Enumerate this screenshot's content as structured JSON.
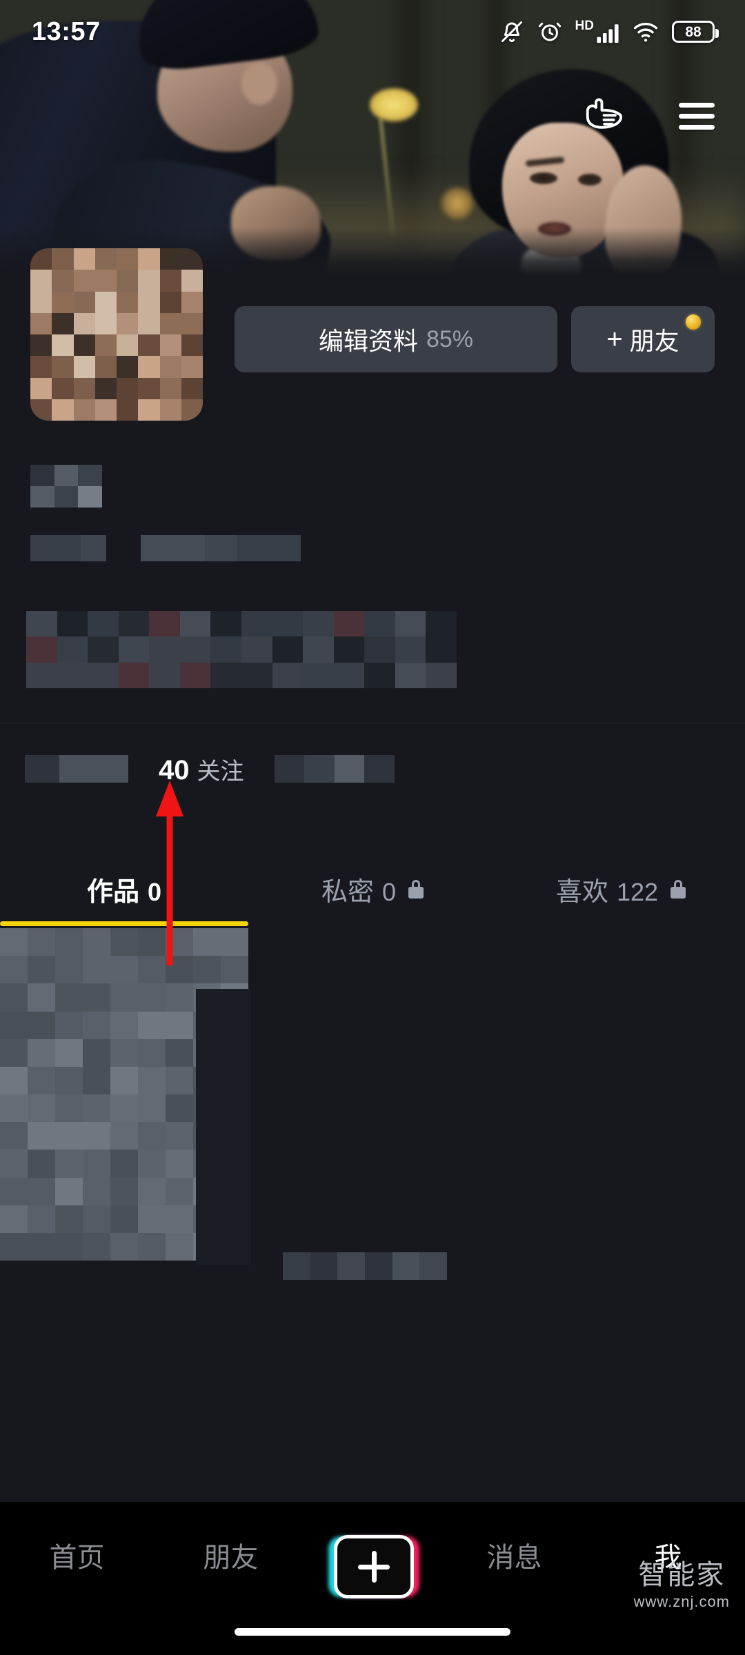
{
  "status_bar": {
    "time": "13:57",
    "hd_label": "HD",
    "battery_level": "88",
    "icons": [
      "bell-mute-icon",
      "alarm-clock-icon",
      "hd-signal-icon",
      "wifi-icon",
      "battery-icon"
    ]
  },
  "cover": {
    "description": "elderly man offering a yellow flower to a woman in a park",
    "pointer_icon": "pointing-hand-icon",
    "menu_icon": "hamburger-menu-icon"
  },
  "profile": {
    "avatar_label": "profile-avatar-mosaic",
    "edit_button": {
      "label": "编辑资料",
      "percent": "85%"
    },
    "friend_button": {
      "plus": "+",
      "label": "朋友",
      "badge": "coin-badge"
    },
    "name_redacted": "",
    "info_redacted": "",
    "bio_redacted": ""
  },
  "stats": {
    "left_redacted": "",
    "following": {
      "count": "40",
      "label": "关注"
    },
    "right_redacted": ""
  },
  "tabs": [
    {
      "label": "作品",
      "count": "0",
      "locked": false,
      "active": true
    },
    {
      "label": "私密",
      "count": "0",
      "locked": true,
      "active": false
    },
    {
      "label": "喜欢",
      "count": "122",
      "locked": true,
      "active": false
    }
  ],
  "content": {
    "card_label": "video-thumbnail-mosaic",
    "caption_redacted": ""
  },
  "annotation": {
    "type": "arrow-up",
    "color": "#f01414",
    "points_to": "40 关注"
  },
  "bottom_nav": [
    {
      "label": "首页",
      "active": false
    },
    {
      "label": "朋友",
      "active": false
    },
    {
      "label": "+",
      "active": false,
      "is_create": true
    },
    {
      "label": "消息",
      "active": false
    },
    {
      "label": "我",
      "active": true
    }
  ],
  "watermark": {
    "cn": "智能家",
    "url": "www.znj.com"
  },
  "colors": {
    "background": "#16181d",
    "nav_background": "#000000",
    "button": "#3a3e47",
    "accent_yellow": "#f5d40a",
    "annotation_red": "#f01414",
    "text_primary": "#ffffff",
    "text_secondary": "#9aa0ac",
    "create_cyan": "#20d5e0",
    "create_pink": "#f6225c"
  }
}
